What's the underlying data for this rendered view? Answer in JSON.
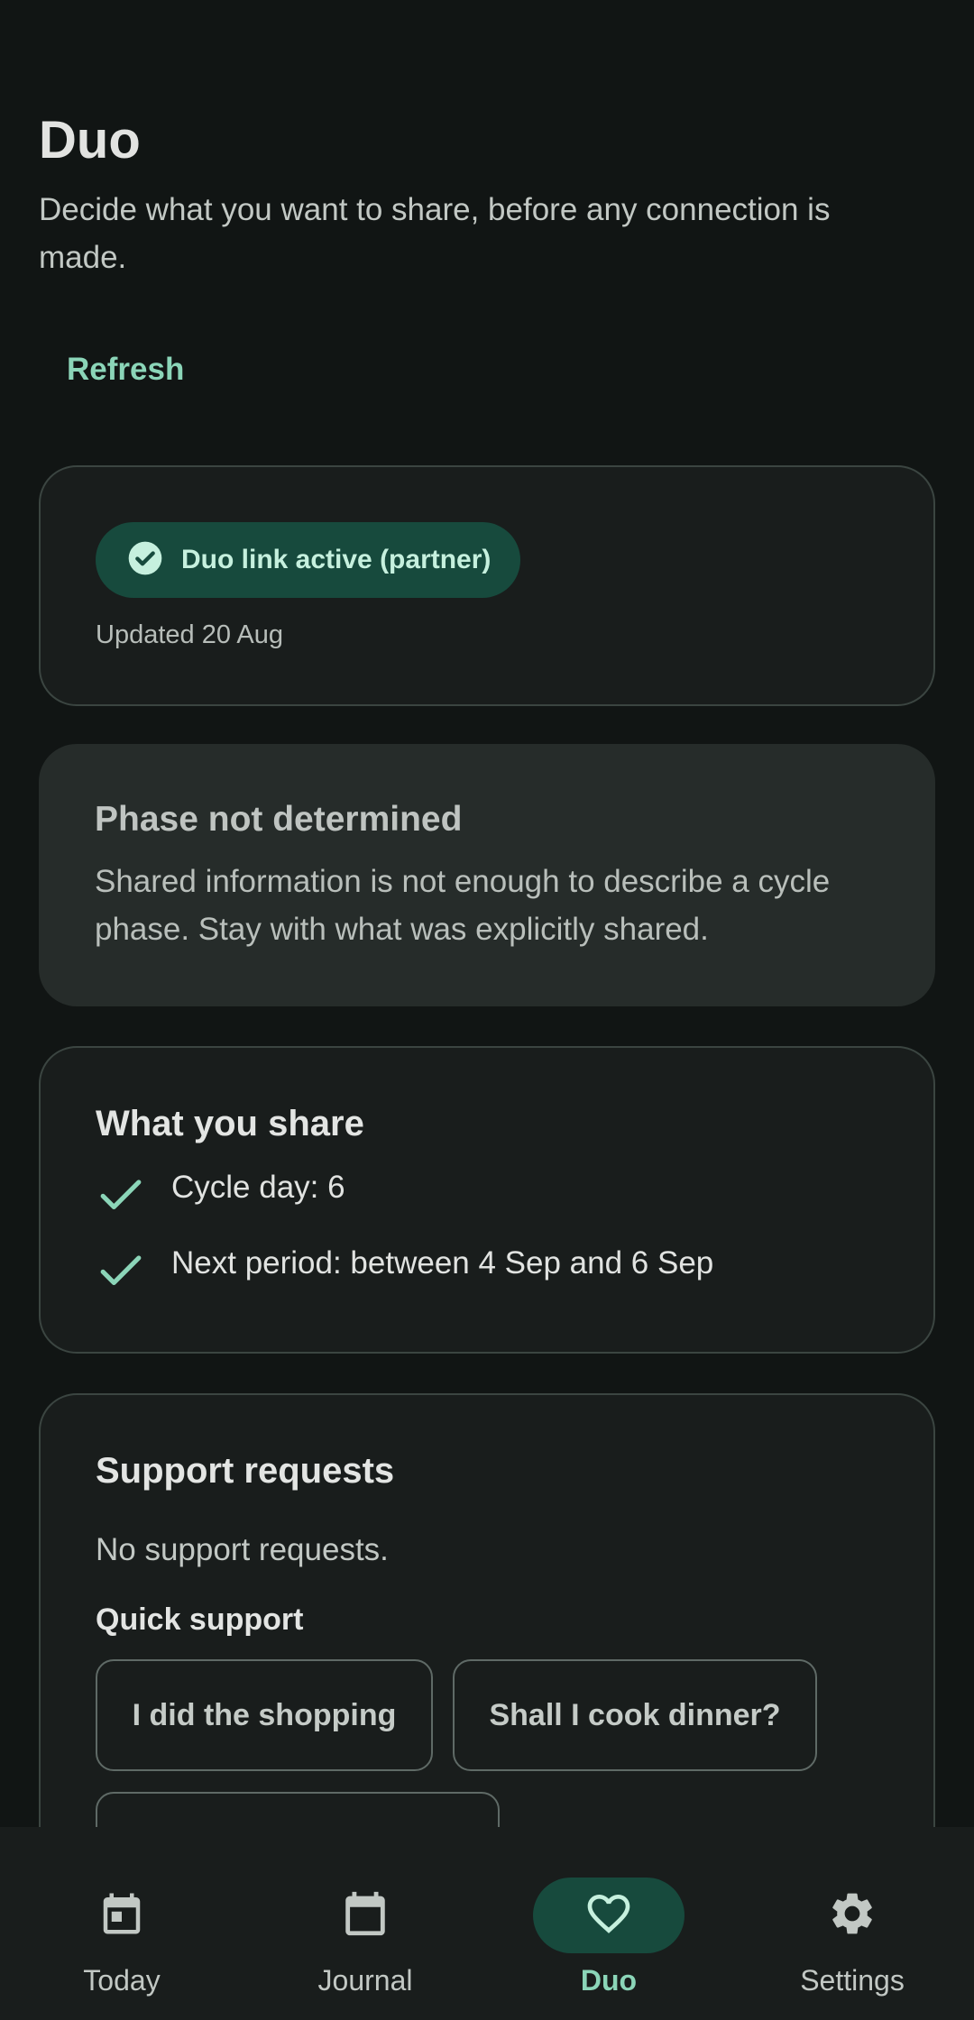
{
  "header": {
    "title": "Duo",
    "subtitle": "Decide what you want to share, before any connection is made.",
    "refresh_label": "Refresh"
  },
  "status": {
    "chip_label": "Duo link active (partner)",
    "updated": "Updated 20 Aug",
    "icon": "check-circle-icon"
  },
  "phase": {
    "title": "Phase not determined",
    "body": "Shared information is not enough to describe a cycle phase. Stay with what was explicitly shared."
  },
  "share": {
    "title": "What you share",
    "items": [
      {
        "label": "Cycle day: 6",
        "icon": "check-icon"
      },
      {
        "label": "Next period: between 4 Sep and 6 Sep",
        "icon": "check-icon"
      }
    ]
  },
  "support": {
    "title": "Support requests",
    "empty_text": "No support requests.",
    "quick_title": "Quick support",
    "quick_actions": [
      "I did the shopping",
      "Shall I cook dinner?"
    ]
  },
  "nav": {
    "items": [
      {
        "label": "Today",
        "icon": "calendar-today-icon",
        "active": false
      },
      {
        "label": "Journal",
        "icon": "calendar-icon",
        "active": false
      },
      {
        "label": "Duo",
        "icon": "heart-icon",
        "active": true
      },
      {
        "label": "Settings",
        "icon": "gear-icon",
        "active": false
      }
    ]
  },
  "colors": {
    "background": "#111514",
    "accent": "#8bd5b8",
    "chip_bg": "#174a3d",
    "card_outline": "#3b4541",
    "card_filled": "#262c2a"
  }
}
